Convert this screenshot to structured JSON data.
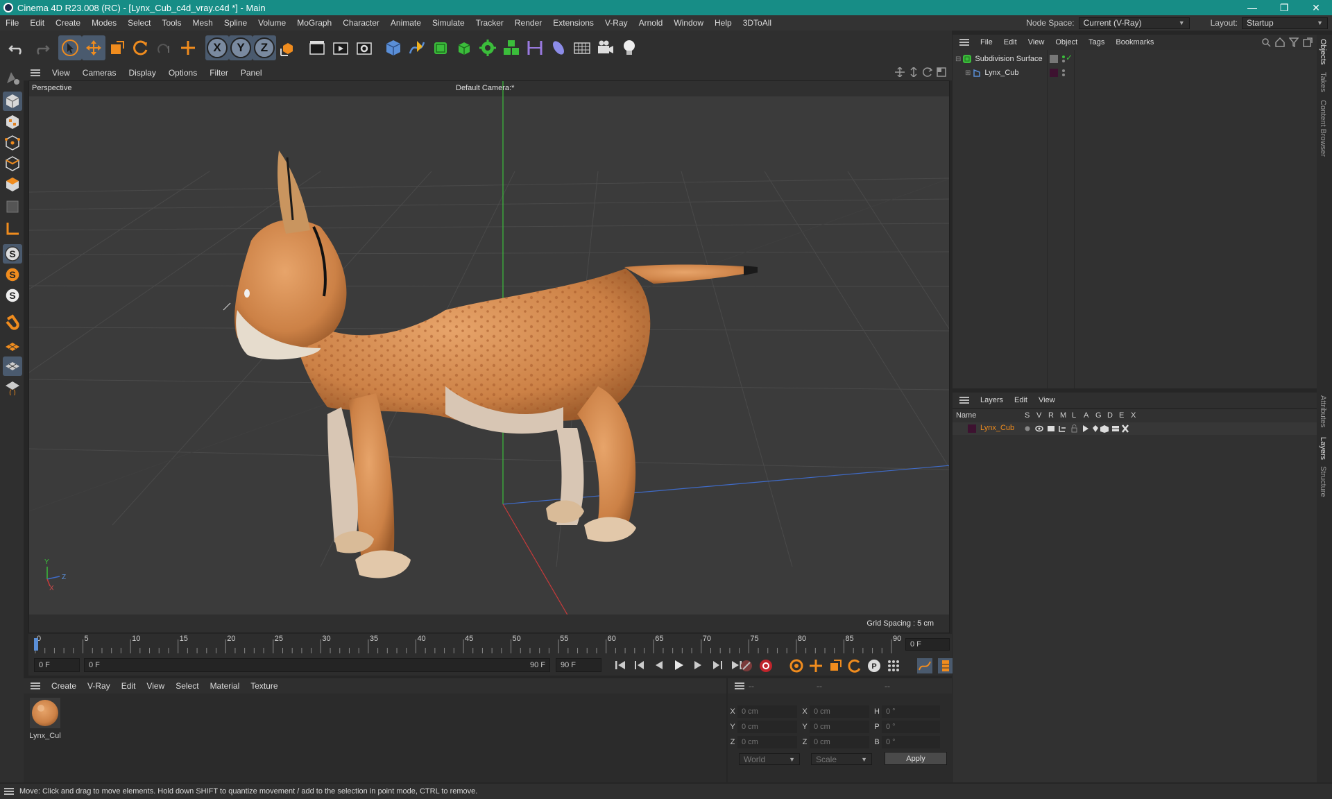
{
  "window": {
    "title": "Cinema 4D R23.008 (RC) - [Lynx_Cub_c4d_vray.c4d *] - Main",
    "minimize": "—",
    "restore": "❐",
    "close": "✕"
  },
  "menubar": {
    "items": [
      "File",
      "Edit",
      "Create",
      "Modes",
      "Select",
      "Tools",
      "Mesh",
      "Spline",
      "Volume",
      "MoGraph",
      "Character",
      "Animate",
      "Simulate",
      "Tracker",
      "Render",
      "Extensions",
      "V-Ray",
      "Arnold",
      "Window",
      "Help",
      "3DToAll"
    ],
    "node_space_label": "Node Space:",
    "node_space_value": "Current (V-Ray)",
    "layout_label": "Layout:",
    "layout_value": "Startup"
  },
  "toolbar": {
    "axis_x": "X",
    "axis_y": "Y",
    "axis_z": "Z"
  },
  "viewport": {
    "menu": [
      "View",
      "Cameras",
      "Display",
      "Options",
      "Filter",
      "Panel"
    ],
    "name": "Perspective",
    "camera": "Default Camera",
    "camera_icon": ":*",
    "grid_spacing": "Grid Spacing : 5 cm",
    "axis_y": "Y",
    "axis_z": "Z",
    "axis_x": "X"
  },
  "timeline": {
    "ticks": [
      "0",
      "5",
      "10",
      "15",
      "20",
      "25",
      "30",
      "35",
      "40",
      "45",
      "50",
      "55",
      "60",
      "65",
      "70",
      "75",
      "80",
      "85",
      "90"
    ],
    "current_frame": "0 F",
    "start_field": "0 F",
    "range_start": "0 F",
    "range_end": "90 F",
    "end_field": "90 F"
  },
  "materials": {
    "menu": [
      "Create",
      "V-Ray",
      "Edit",
      "View",
      "Select",
      "Material",
      "Texture"
    ],
    "items": [
      {
        "name": "Lynx_Cul"
      }
    ]
  },
  "coordinates": {
    "header": [
      "--",
      "--",
      "--"
    ],
    "rows": [
      {
        "l1": "X",
        "v1": "0 cm",
        "l2": "X",
        "v2": "0 cm",
        "l3": "H",
        "v3": "0 °"
      },
      {
        "l1": "Y",
        "v1": "0 cm",
        "l2": "Y",
        "v2": "0 cm",
        "l3": "P",
        "v3": "0 °"
      },
      {
        "l1": "Z",
        "v1": "0 cm",
        "l2": "Z",
        "v2": "0 cm",
        "l3": "B",
        "v3": "0 °"
      }
    ],
    "space": "World",
    "mode": "Scale",
    "apply": "Apply"
  },
  "objects": {
    "menu": [
      "File",
      "Edit",
      "View",
      "Object",
      "Tags",
      "Bookmarks"
    ],
    "items": [
      {
        "name": "Subdivision Surface"
      },
      {
        "name": "Lynx_Cub"
      }
    ]
  },
  "layers": {
    "menu": [
      "Layers",
      "Edit",
      "View"
    ],
    "columns": [
      "Name",
      "S",
      "V",
      "R",
      "M",
      "L",
      "A",
      "G",
      "D",
      "E",
      "X"
    ],
    "rows": [
      {
        "name": "Lynx_Cub",
        "color": "#3d1230"
      }
    ]
  },
  "side_tabs": [
    "Objects",
    "Takes",
    "Content Browser",
    "Attributes",
    "Layers",
    "Structure"
  ],
  "status": "Move: Click and drag to move elements. Hold down SHIFT to quantize movement / add to the selection in point mode, CTRL to remove.",
  "colors": {
    "titlebar": "#178d86",
    "accent_orange": "#f08c1e",
    "accent_blue": "#5a8fd8",
    "object_green": "#3bbd3b"
  }
}
